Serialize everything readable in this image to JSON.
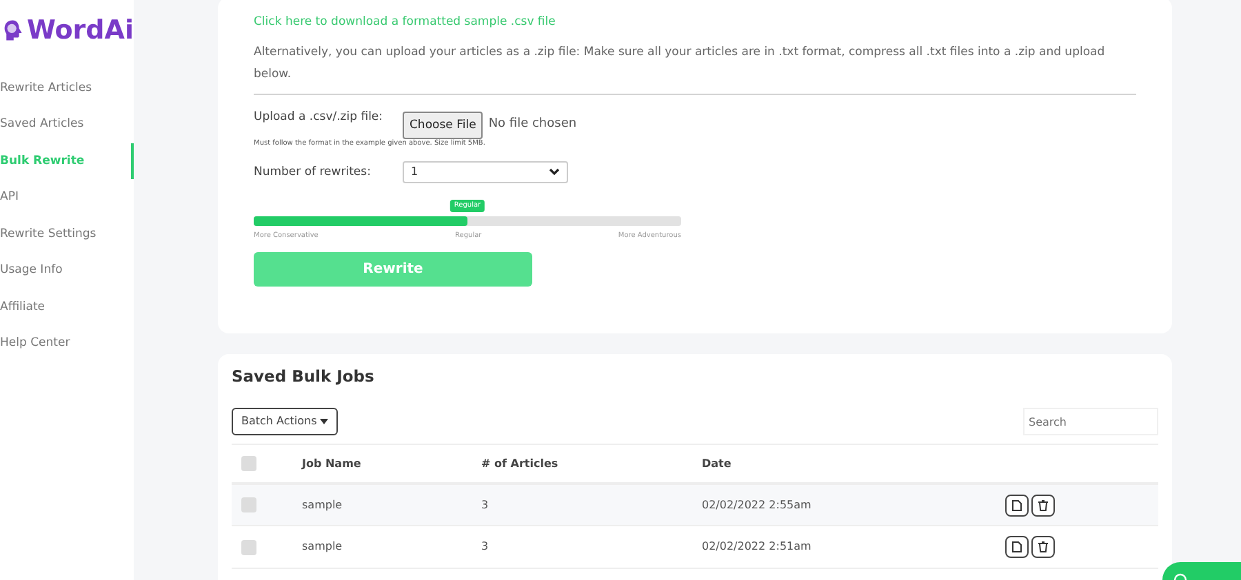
{
  "logo": {
    "text": "WordAi"
  },
  "sidebar": {
    "items": [
      {
        "label": "Rewrite Articles",
        "selected": false
      },
      {
        "label": "Saved Articles",
        "selected": false
      },
      {
        "label": "Bulk Rewrite",
        "selected": true
      },
      {
        "label": "API",
        "selected": false
      },
      {
        "label": "Rewrite Settings",
        "selected": false
      },
      {
        "label": "Usage Info",
        "selected": false
      },
      {
        "label": "Affiliate",
        "selected": false
      },
      {
        "label": "Help Center",
        "selected": false
      }
    ]
  },
  "upload_card": {
    "download_link": "Click here to download a formatted sample .csv file",
    "zip_note": "Alternatively, you can upload your articles as a .zip file: Make sure all your articles are in .txt format, compress all .txt files into a .zip and upload below.",
    "upload_label": "Upload a .csv/.zip file:",
    "choose_button": "Choose File",
    "file_status": "No file chosen",
    "upload_hint": "Must follow the format in the example given above. Size limit 5MB.",
    "rewrites_label": "Number of rewrites:",
    "rewrites_value": "1",
    "slider": {
      "level": 0.5,
      "bubble": "Regular",
      "ticks": [
        "More Conservative",
        "Regular",
        "More Adventurous"
      ]
    },
    "rewrite_button": "Rewrite"
  },
  "jobs_card": {
    "title": "Saved Bulk Jobs",
    "batch_button": "Batch Actions",
    "search": {
      "placeholder": "Search"
    },
    "table": {
      "columns": [
        "Job Name",
        "# of Articles",
        "Date"
      ],
      "header_checked": false,
      "rows": [
        {
          "checked": false,
          "cells": [
            "sample",
            "3",
            "02/02/2022 2:55am"
          ]
        },
        {
          "checked": false,
          "cells": [
            "sample",
            "3",
            "02/02/2022 2:51am"
          ]
        }
      ]
    }
  }
}
